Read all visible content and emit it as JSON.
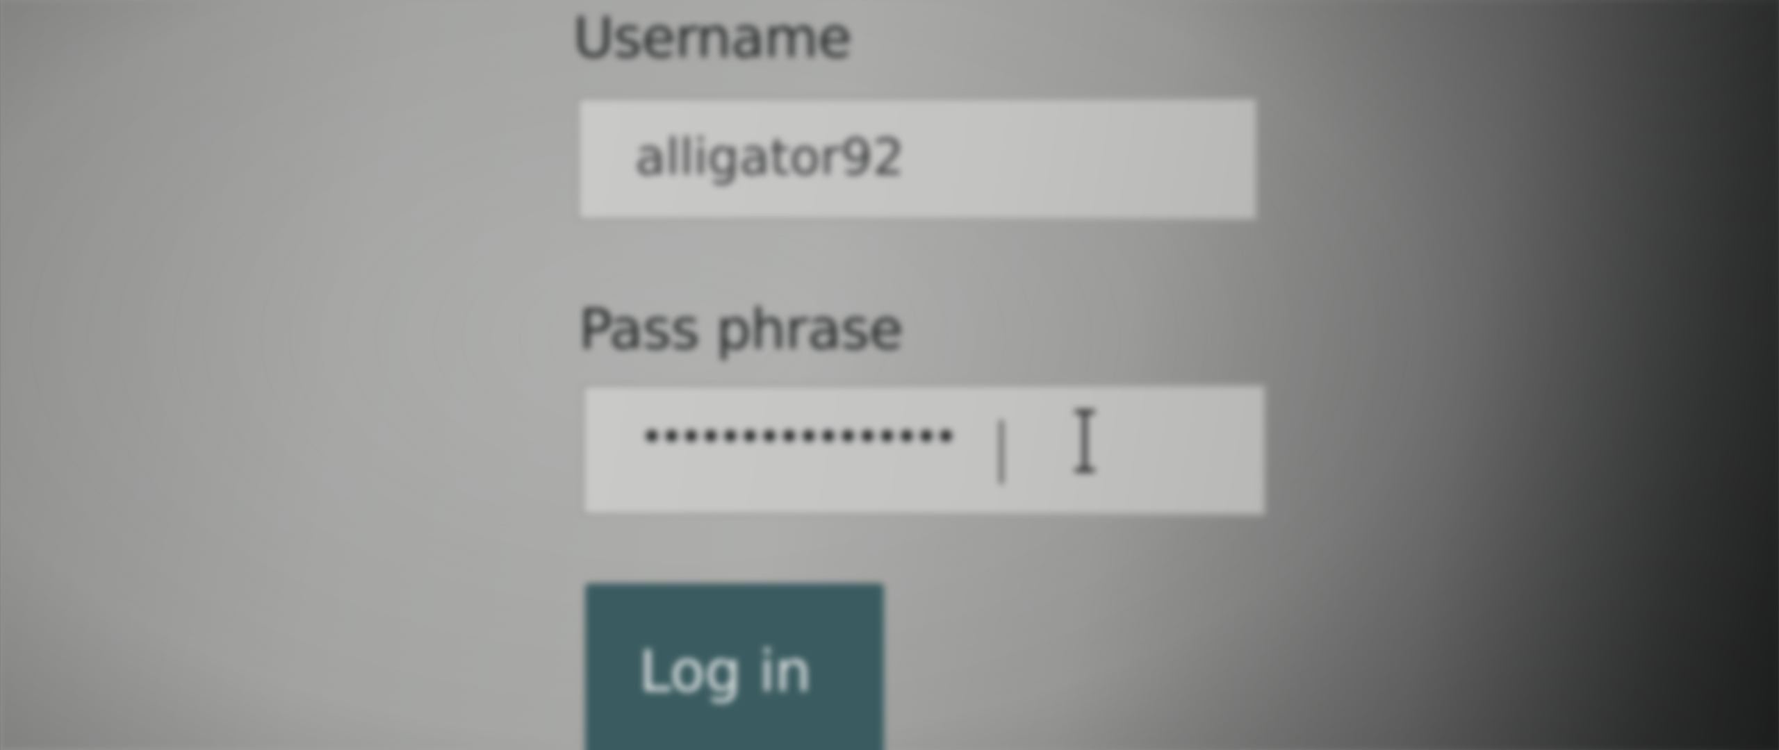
{
  "form": {
    "username_label": "Username",
    "username_value": "alligator92",
    "pass_label": "Pass phrase",
    "pass_value_masked": "••••••••••••••••",
    "login_label": "Log in"
  },
  "icons": {
    "cursor": "text-ibeam-icon"
  },
  "colors": {
    "button": "#3a5c60",
    "button_text": "#e6e9e8"
  }
}
